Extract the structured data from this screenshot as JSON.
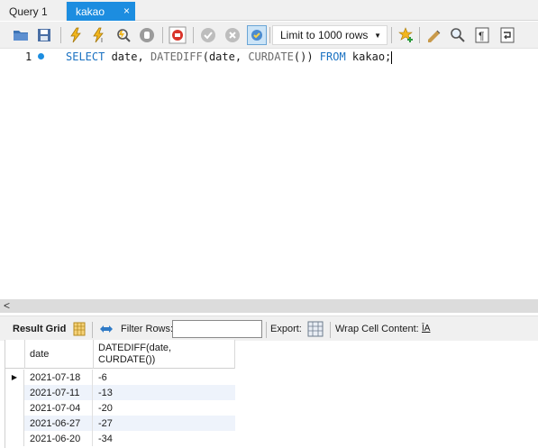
{
  "tabs": [
    {
      "label": "Query 1",
      "active": false
    },
    {
      "label": "kakao",
      "active": true
    }
  ],
  "tab_close_glyph": "×",
  "toolbar": {
    "limit_select_value": "Limit to 1000 rows",
    "icons": [
      "open-folder-icon",
      "save-icon",
      "execute-icon",
      "execute-current-icon",
      "explain-icon",
      "stop-icon",
      "toggle-error-icon",
      "commit-icon",
      "rollback-icon",
      "autocommit-icon",
      "add-snippet-icon",
      "beautify-icon",
      "find-icon",
      "invisible-chars-icon",
      "wrap-icon"
    ]
  },
  "editor": {
    "line_number": "1",
    "sql": {
      "kw1": "SELECT",
      "p1": " date, ",
      "fn1": "DATEDIFF",
      "p2": "(date, ",
      "fn2": "CURDATE",
      "p3": "()) ",
      "kw2": "FROM",
      "p4": " kakao;"
    }
  },
  "scroll_left_glyph": "<",
  "result_toolbar": {
    "result_grid_label": "Result Grid",
    "filter_rows_label": "Filter Rows:",
    "filter_value": "",
    "export_label": "Export:",
    "wrap_label": "Wrap Cell Content:",
    "wrap_icon_glyph": "ĪA"
  },
  "grid": {
    "columns": [
      "date",
      "DATEDIFF(date,\nCURDATE())"
    ],
    "col2_line1": "DATEDIFF(date,",
    "col2_line2": "CURDATE())",
    "current_row_marker": "▶",
    "rows": [
      {
        "date": "2021-07-18",
        "diff": "-6"
      },
      {
        "date": "2021-07-11",
        "diff": "-13"
      },
      {
        "date": "2021-07-04",
        "diff": "-20"
      },
      {
        "date": "2021-06-27",
        "diff": "-27"
      },
      {
        "date": "2021-06-20",
        "diff": "-34"
      }
    ]
  },
  "colors": {
    "accent": "#1c8de0",
    "keyword": "#1b72c2",
    "alt_row": "#eef3fb"
  }
}
